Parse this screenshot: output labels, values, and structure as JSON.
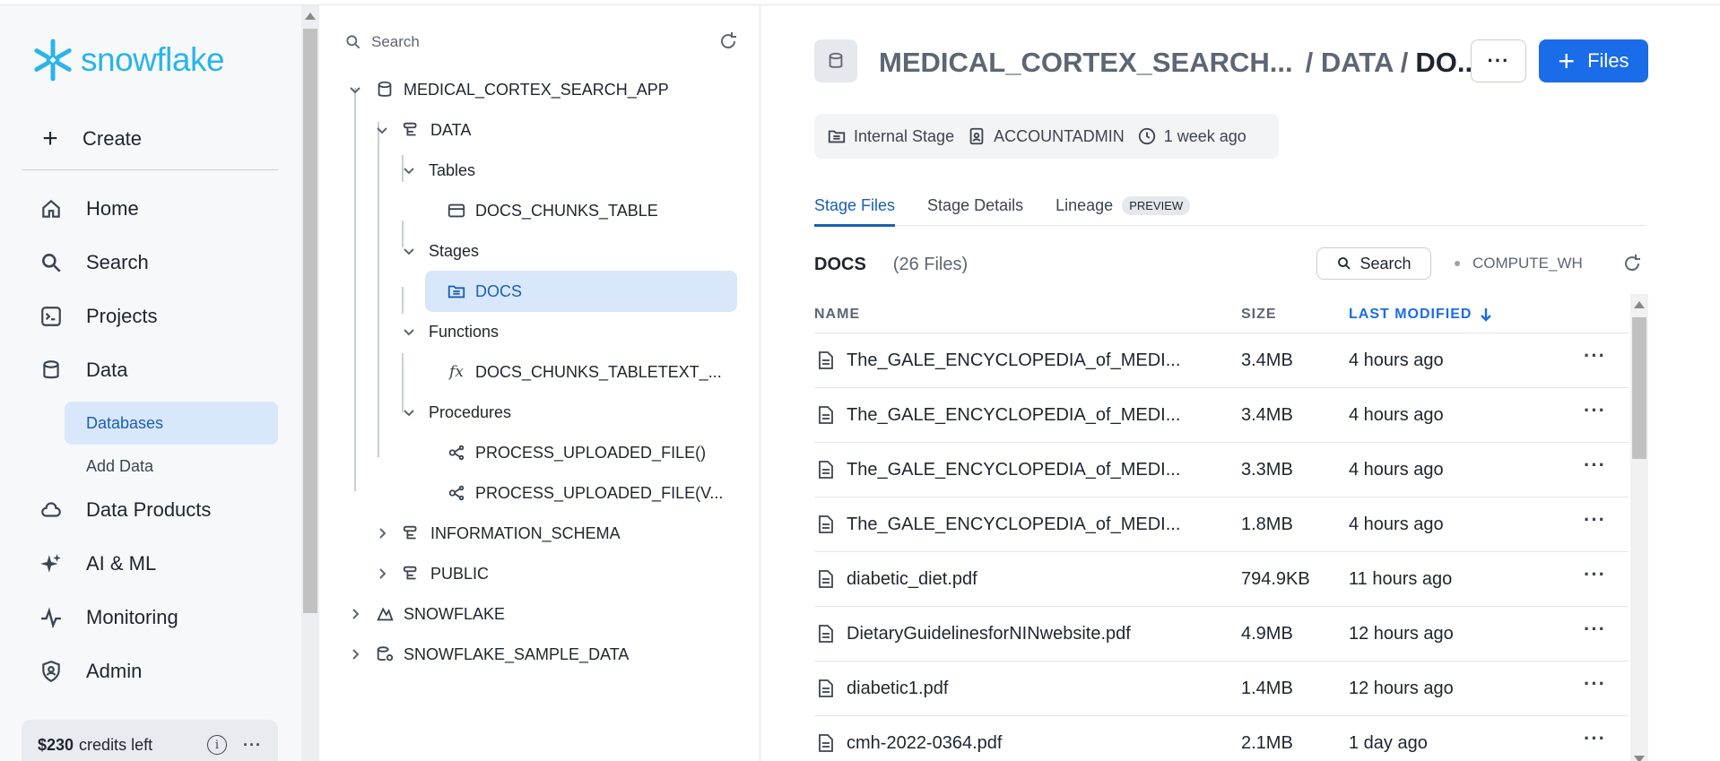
{
  "logo": {
    "text": "snowflake"
  },
  "nav": {
    "create_label": "Create",
    "items": [
      {
        "label": "Home",
        "icon": "home-icon"
      },
      {
        "label": "Search",
        "icon": "search-icon"
      },
      {
        "label": "Projects",
        "icon": "projects-icon"
      },
      {
        "label": "Data",
        "icon": "database-icon"
      },
      {
        "label": "Data Products",
        "icon": "cloud-icon"
      },
      {
        "label": "AI & ML",
        "icon": "sparkle-icon"
      },
      {
        "label": "Monitoring",
        "icon": "pulse-icon"
      },
      {
        "label": "Admin",
        "icon": "shield-icon"
      }
    ],
    "sub_items": [
      {
        "label": "Databases",
        "active": true
      },
      {
        "label": "Add Data",
        "active": false
      }
    ],
    "credits_amount": "$230",
    "credits_text": "credits left"
  },
  "tree": {
    "search_placeholder": "Search",
    "nodes": [
      {
        "label": "MEDICAL_CORTEX_SEARCH_APP",
        "icon": "database-icon"
      },
      {
        "label": "DATA",
        "icon": "schema-icon"
      },
      {
        "label": "Tables"
      },
      {
        "label": "DOCS_CHUNKS_TABLE",
        "icon": "table-icon"
      },
      {
        "label": "Stages"
      },
      {
        "label": "DOCS",
        "icon": "stage-icon",
        "selected": true
      },
      {
        "label": "Functions"
      },
      {
        "label": "DOCS_CHUNKS_TABLETEXT_...",
        "icon": "function-icon"
      },
      {
        "label": "Procedures"
      },
      {
        "label": "PROCESS_UPLOADED_FILE()",
        "icon": "procedure-icon"
      },
      {
        "label": "PROCESS_UPLOADED_FILE(V...",
        "icon": "procedure-icon"
      },
      {
        "label": "INFORMATION_SCHEMA",
        "icon": "schema-icon"
      },
      {
        "label": "PUBLIC",
        "icon": "schema-icon"
      },
      {
        "label": "SNOWFLAKE",
        "icon": "shared-db-icon"
      },
      {
        "label": "SNOWFLAKE_SAMPLE_DATA",
        "icon": "shared-db-icon"
      }
    ]
  },
  "header": {
    "crumb_db": "MEDICAL_CORTEX_SEARCH...",
    "crumb_schema": "/ DATA /",
    "crumb_current": "DO...",
    "more_label": "···",
    "files_button": "Files"
  },
  "meta": {
    "type": "Internal Stage",
    "owner": "ACCOUNTADMIN",
    "updated": "1 week ago"
  },
  "tabs": [
    {
      "label": "Stage Files",
      "active": true
    },
    {
      "label": "Stage Details",
      "active": false
    },
    {
      "label": "Lineage",
      "badge": "PREVIEW",
      "active": false
    }
  ],
  "list": {
    "title": "DOCS",
    "count": "(26 Files)",
    "search_label": "Search",
    "warehouse": "COMPUTE_WH",
    "columns": {
      "name": "NAME",
      "size": "SIZE",
      "modified": "LAST MODIFIED"
    },
    "rows": [
      {
        "name": "The_GALE_ENCYCLOPEDIA_of_MEDI...",
        "size": "3.4MB",
        "modified": "4 hours ago"
      },
      {
        "name": "The_GALE_ENCYCLOPEDIA_of_MEDI...",
        "size": "3.4MB",
        "modified": "4 hours ago"
      },
      {
        "name": "The_GALE_ENCYCLOPEDIA_of_MEDI...",
        "size": "3.3MB",
        "modified": "4 hours ago"
      },
      {
        "name": "The_GALE_ENCYCLOPEDIA_of_MEDI...",
        "size": "1.8MB",
        "modified": "4 hours ago"
      },
      {
        "name": "diabetic_diet.pdf",
        "size": "794.9KB",
        "modified": "11 hours ago"
      },
      {
        "name": "DietaryGuidelinesforNINwebsite.pdf",
        "size": "4.9MB",
        "modified": "12 hours ago"
      },
      {
        "name": "diabetic1.pdf",
        "size": "1.4MB",
        "modified": "12 hours ago"
      },
      {
        "name": "cmh-2022-0364.pdf",
        "size": "2.1MB",
        "modified": "1 day ago"
      }
    ]
  },
  "colors": {
    "accent": "#1a6ce8",
    "logo": "#29b5e8",
    "selected_bg": "#d9e7fb"
  }
}
